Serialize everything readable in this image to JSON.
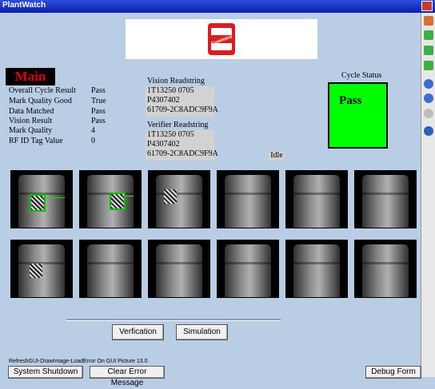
{
  "window": {
    "title": "PlantWatch"
  },
  "main_title": "Main",
  "results": [
    {
      "label": "Overall Cycle Result",
      "value": "Pass"
    },
    {
      "label": "Mark Quality Good",
      "value": "True"
    },
    {
      "label": "Data Matched",
      "value": "Pass"
    },
    {
      "label": "Vision Result",
      "value": "Pass"
    },
    {
      "label": "Mark Quality",
      "value": "4"
    },
    {
      "label": "RF ID Tag Value",
      "value": "0"
    }
  ],
  "vision": {
    "heading": "Vision Readstring",
    "lines": [
      "1T13250 0705",
      "P4307402",
      "61709-2C8ADC9F9A"
    ]
  },
  "verifier": {
    "heading": "Verifier Readstring",
    "lines": [
      "1T13250 0705",
      "P4307402",
      "61709-2C8ADC9F9A"
    ]
  },
  "idle_label": "Idle",
  "cycle_status": {
    "heading": "Cycle Status",
    "value": "Pass",
    "color": "#00ff00"
  },
  "buttons": {
    "verification": "Verfication",
    "simulation": "Simulation",
    "shutdown": "System Shutdown",
    "clear_error": "Clear Error Message",
    "debug": "Debug Form"
  },
  "status_line": "RefreshGUI-DrawImage-LoadError On GUI Picture 13.0",
  "icons": [
    "camera-icon",
    "microphone-icon",
    "video-icon",
    "chat-icon",
    "pause-icon",
    "clock-icon",
    "stop-icon",
    "compass-icon"
  ],
  "colors": {
    "background": "#b9cde5",
    "pass": "#00ff00",
    "main_title": "#e00000",
    "brand": "#d81e1e"
  }
}
